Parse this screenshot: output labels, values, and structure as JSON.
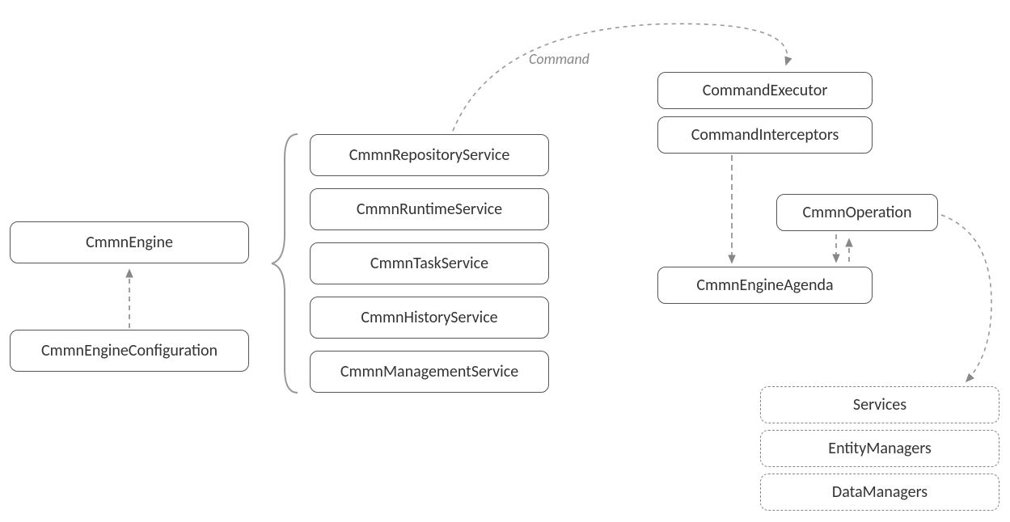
{
  "boxes": {
    "cmmn_engine": "CmmnEngine",
    "cmmn_engine_configuration": "CmmnEngineConfiguration",
    "repository_service": "CmmnRepositoryService",
    "runtime_service": "CmmnRuntimeService",
    "task_service": "CmmnTaskService",
    "history_service": "CmmnHistoryService",
    "management_service": "CmmnManagementService",
    "command_executor": "CommandExecutor",
    "command_interceptors": "CommandInterceptors",
    "cmmn_operation": "CmmnOperation",
    "cmmn_engine_agenda": "CmmnEngineAgenda",
    "services": "Services",
    "entity_managers": "EntityManagers",
    "data_managers": "DataManagers"
  },
  "labels": {
    "command": "Command"
  }
}
